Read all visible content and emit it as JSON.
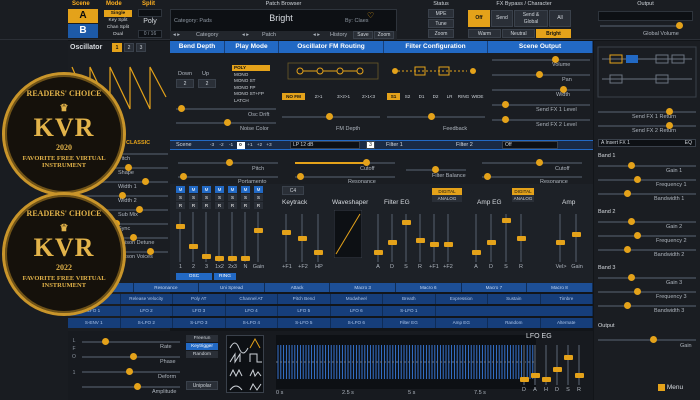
{
  "header": {
    "scene_label": "Scene",
    "mode_label": "Mode",
    "split_label": "Split",
    "scene_a": "A",
    "scene_b": "B",
    "modes": [
      "Single",
      "Key Split",
      "Chan Split",
      "Dual"
    ],
    "poly": "Poly",
    "poly_value": "0 / 16",
    "patch_browser_label": "Patch Browser",
    "category": "Category: Pads",
    "patch_name": "Bright",
    "author": "By: Claes",
    "category_nav": "Category",
    "patch_nav": "Patch",
    "history": "History",
    "history_btns": [
      "Save",
      "Zoom"
    ],
    "status_label": "Status",
    "status_btns": [
      "MPE",
      "Tune",
      "Zoom"
    ],
    "fx_label": "FX Bypass / Character",
    "fx_btns": [
      "Off",
      "Send",
      "Send & Global",
      "All"
    ],
    "character_btns": [
      "Warm",
      "Neutral",
      "Bright"
    ],
    "output_label": "Output",
    "global_volume": "Global Volume"
  },
  "oscillator": {
    "title": "Oscillator",
    "tabs": [
      "1",
      "2",
      "3"
    ],
    "classic": "CLASSIC",
    "params": [
      "Pitch",
      "Shape",
      "Width 1",
      "Width 2",
      "Sub Mix",
      "Sync",
      "Unison Detune",
      "Unison Voices"
    ]
  },
  "sections": {
    "bend": "Bend Depth",
    "play": "Play Mode",
    "fm": "Oscillator FM Routing",
    "filter_cfg": "Filter Configuration",
    "scene_out": "Scene Output",
    "down": "Down",
    "up": "Up",
    "down_val": "2",
    "up_val": "2",
    "play_modes": [
      "POLY",
      "MONO",
      "MONO ST",
      "MONO FP",
      "MONO ST+FP",
      "LATCH"
    ],
    "osc_drift": "Osc Drift",
    "noise_color": "Noise Color",
    "fm_depth": "FM Depth",
    "feedback": "Feedback",
    "volume": "Volume",
    "pan": "Pan",
    "width": "Width",
    "send1": "Send FX 1 Level",
    "send2": "Send FX 2 Level",
    "fm_modes": [
      "NO FM",
      "2>1",
      "3>2>1",
      "2>1<3"
    ],
    "filter_modes": [
      "S1",
      "S2",
      "D1",
      "D2",
      "LR",
      "RING",
      "WIDE"
    ]
  },
  "scene_bar": {
    "scene": "Scene",
    "pitch_vals": [
      "-3",
      "-2",
      "-1",
      "0",
      "+1",
      "+2",
      "+3"
    ],
    "filter_type": "LP 12 dB",
    "filter1": "Filter 1",
    "filter2": "Filter 2",
    "off": "Off",
    "pitch": "Pitch",
    "portamento": "Portamento",
    "cutoff": "Cutoff",
    "resonance": "Resonance",
    "filter_balance": "Filter Balance",
    "cutoff2": "Cutoff",
    "resonance2": "Resonance"
  },
  "mixer": {
    "labels": [
      "1",
      "2",
      "3",
      "1x2",
      "2x3",
      "N",
      "Gain"
    ],
    "osc": "OSC",
    "ring": "RING",
    "keytrack": "Keytrack",
    "waveshaper": "Waveshaper",
    "filter_eg": "Filter EG",
    "amp_eg": "Amp EG",
    "amp": "Amp",
    "keytrack_vals": [
      "+F1",
      "+F2",
      "HP"
    ],
    "eg_labels": [
      "A",
      "D",
      "S",
      "R"
    ],
    "filt_extra": [
      "+F1",
      "+F2"
    ],
    "amp_extra": [
      "Vel>",
      "Gain"
    ],
    "digital": "DIGITAL",
    "analog": "ANALOG"
  },
  "mod_row1": [
    "Filter",
    "Resonance",
    "Uni Spread",
    "Attack",
    "Macro 3",
    "Macro 6",
    "Macro 7",
    "Macro 8"
  ],
  "mod_row2": [
    "Velocity",
    "Release Velocity",
    "Poly AT",
    "Channel AT",
    "Pitch Bend",
    "Modwheel",
    "Breath",
    "Expression",
    "Sustain",
    "Timbre"
  ],
  "mod_row3": [
    "LFO 1",
    "LFO 2",
    "LFO 3",
    "LFO 4",
    "LFO 5",
    "LFO 6",
    "S-LFO 1"
  ],
  "mod_row4": [
    "S-ENV 1",
    "S-LFO 2",
    "S-LFO 3",
    "S-LFO 4",
    "S-LFO 5",
    "S-LFO 6",
    "Filter EG",
    "Amp EG",
    "Random",
    "Alternate"
  ],
  "mod_row4b": [
    "Keytrack",
    "Lowest Key",
    "Highest Key",
    "Latest Key"
  ],
  "lfo": {
    "vertical": "LFO 1",
    "params": [
      "Rate",
      "Phase",
      "Deform",
      "Amplitude"
    ],
    "modes": [
      "Freerun",
      "Keytrigger",
      "Random"
    ],
    "unipolar": "Unipolar",
    "time_labels": [
      "0 s",
      "2.5 s",
      "5 s",
      "7.5 s"
    ],
    "eg_title": "LFO EG",
    "eg_labels": [
      "D",
      "A",
      "H",
      "D",
      "S",
      "R"
    ]
  },
  "fx": {
    "return1": "Send FX 1 Return",
    "return2": "Send FX 2 Return",
    "insert": "A Insert FX 1",
    "eq": "EQ",
    "bands": [
      {
        "title": "Band 1",
        "p": [
          "Gain 1",
          "Frequency 1",
          "Bandwidth 1"
        ]
      },
      {
        "title": "Band 2",
        "p": [
          "Gain 2",
          "Frequency 2",
          "Bandwidth 2"
        ]
      },
      {
        "title": "Band 3",
        "p": [
          "Gain 3",
          "Frequency 3",
          "Bandwidth 3"
        ]
      }
    ],
    "output": "Output",
    "gain": "Gain",
    "menu": "Menu"
  },
  "badges": [
    {
      "top": "READERS' CHOICE",
      "logo": "KVR",
      "year": "2020",
      "bottom": "FAVORITE FREE VIRTUAL INSTRUMENT"
    },
    {
      "top": "READERS' CHOICE",
      "logo": "KVR",
      "year": "2022",
      "bottom": "FAVORITE FREE VIRTUAL INSTRUMENT"
    }
  ],
  "colors": {
    "accent": "#e4a21a",
    "blue": "#2269c4",
    "bg": "#1a1d22"
  }
}
